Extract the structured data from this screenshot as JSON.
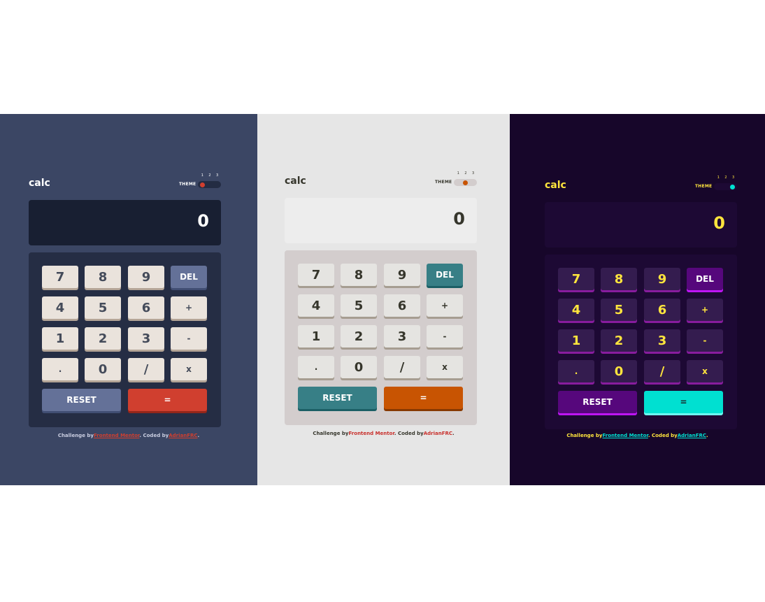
{
  "themes": [
    {
      "logo": "calc",
      "theme_label": "THEME",
      "theme_numbers": [
        "1",
        "2",
        "3"
      ],
      "active_theme": "1",
      "display_value": "0",
      "keys": {
        "seven": "7",
        "eight": "8",
        "nine": "9",
        "del": "DEL",
        "four": "4",
        "five": "5",
        "six": "6",
        "plus": "+",
        "one": "1",
        "two": "2",
        "three": "3",
        "minus": "-",
        "dot": ".",
        "zero": "0",
        "divide": "/",
        "times": "x",
        "reset": "RESET",
        "equals": "="
      },
      "footer": {
        "prefix": "Challenge by",
        "link1": "Frontend Mentor",
        "middle": ". Coded by",
        "link2": "AdrianFRC",
        "suffix": "."
      },
      "colors": {
        "background": "#3b4664",
        "screen": "#181f32",
        "keypad": "#252d44",
        "key": "#eae3dc",
        "accent": "#647198",
        "equals": "#d03f2f"
      }
    },
    {
      "logo": "calc",
      "theme_label": "THEME",
      "theme_numbers": [
        "1",
        "2",
        "3"
      ],
      "active_theme": "2",
      "display_value": "0",
      "keys": {
        "seven": "7",
        "eight": "8",
        "nine": "9",
        "del": "DEL",
        "four": "4",
        "five": "5",
        "six": "6",
        "plus": "+",
        "one": "1",
        "two": "2",
        "three": "3",
        "minus": "-",
        "dot": ".",
        "zero": "0",
        "divide": "/",
        "times": "x",
        "reset": "RESET",
        "equals": "="
      },
      "footer": {
        "prefix": "Challenge by",
        "link1": "Frontend Mentor",
        "middle": ". Coded by",
        "link2": "AdrianFRC",
        "suffix": "."
      },
      "colors": {
        "background": "#e6e6e6",
        "screen": "#ededed",
        "keypad": "#d3cdcd",
        "key": "#e5e4e1",
        "accent": "#377f86",
        "equals": "#c85402"
      }
    },
    {
      "logo": "calc",
      "theme_label": "THEME",
      "theme_numbers": [
        "1",
        "2",
        "3"
      ],
      "active_theme": "3",
      "display_value": "0",
      "keys": {
        "seven": "7",
        "eight": "8",
        "nine": "9",
        "del": "DEL",
        "four": "4",
        "five": "5",
        "six": "6",
        "plus": "+",
        "one": "1",
        "two": "2",
        "three": "3",
        "minus": "-",
        "dot": ".",
        "zero": "0",
        "divide": "/",
        "times": "x",
        "reset": "RESET",
        "equals": "="
      },
      "footer": {
        "prefix": "Challenge by",
        "link1": "Frontend Mentor",
        "middle": ". Coded by",
        "link2": "AdrianFRC",
        "suffix": "."
      },
      "colors": {
        "background": "#17062a",
        "screen": "#1d0934",
        "keypad": "#1d0934",
        "key": "#341c4f",
        "accent": "#56077c",
        "equals": "#00e0d1"
      }
    }
  ]
}
